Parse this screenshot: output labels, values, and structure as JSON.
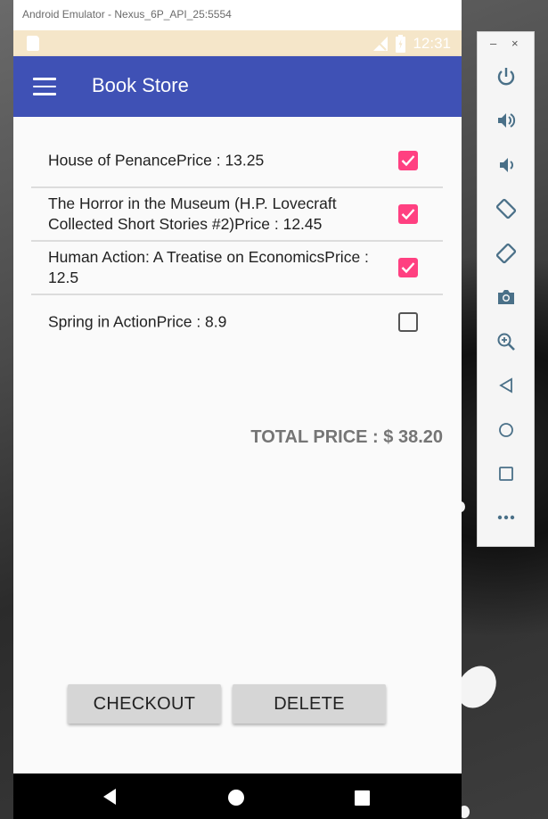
{
  "window": {
    "title": "Android Emulator - Nexus_6P_API_25:5554",
    "min_glyph": "–",
    "close_glyph": "×"
  },
  "status_bar": {
    "time": "12:31",
    "icons": [
      "sd-card-icon",
      "signal-icon",
      "battery-icon"
    ]
  },
  "app_bar": {
    "title": "Book Store",
    "nav_icon": "menu-icon"
  },
  "books": [
    {
      "label": "House of PenancePrice : 13.25",
      "checked": true
    },
    {
      "label": "The Horror in the Museum (H.P. Lovecraft Collected Short Stories #2)Price : 12.45",
      "checked": true
    },
    {
      "label": "Human Action: A Treatise on EconomicsPrice : 12.5",
      "checked": true
    },
    {
      "label": "Spring in ActionPrice : 8.9",
      "checked": false
    }
  ],
  "total_price": "TOTAL PRICE : $ 38.20",
  "buttons": {
    "checkout": "CHECKOUT",
    "delete": "DELETE"
  },
  "nav_bar": [
    "back-icon",
    "home-icon",
    "recents-icon"
  ],
  "side_toolbar": [
    "power-icon",
    "volume-up-icon",
    "volume-down-icon",
    "rotate-left-icon",
    "rotate-right-icon",
    "camera-icon",
    "zoom-icon",
    "back-icon",
    "home-icon",
    "overview-icon",
    "more-icon"
  ],
  "colors": {
    "primary": "#3f51b5",
    "accent": "#ff4081",
    "status_bar": "#f5e6c9",
    "button": "#d6d6d6",
    "toolbar_icon": "#4a7088"
  }
}
